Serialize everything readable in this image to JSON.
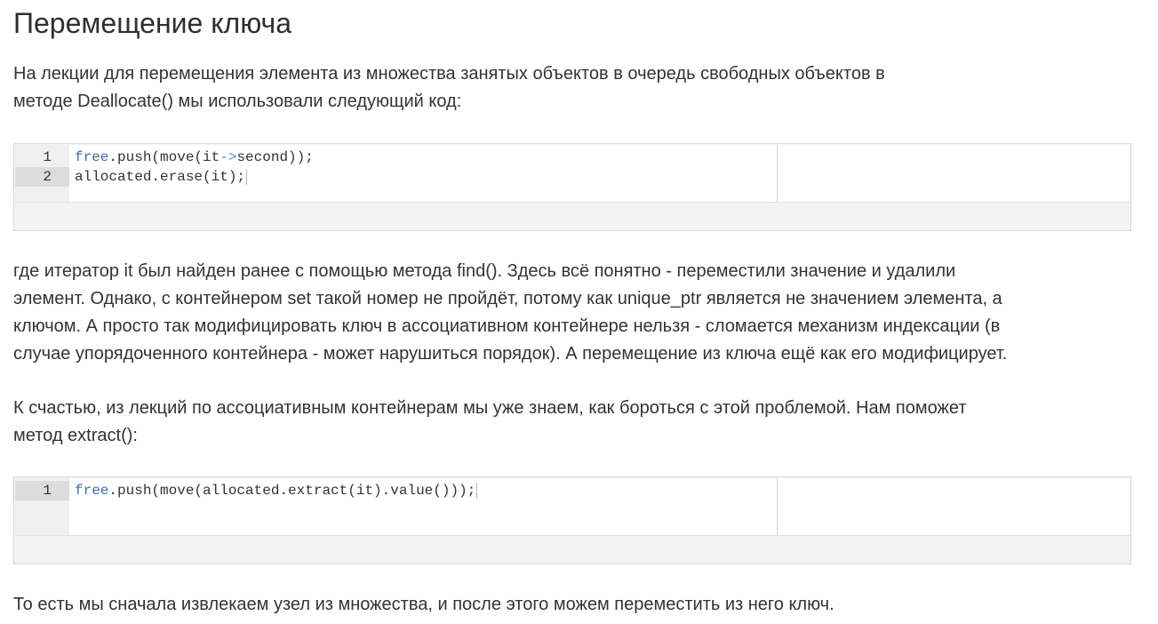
{
  "heading": "Перемещение ключа",
  "intro": [
    "На лекции для перемещения элемента из множества занятых объектов в очередь свободных объектов в",
    "методе Deallocate() мы использовали следующий код:"
  ],
  "code1": {
    "line_numbers": [
      "1",
      "2"
    ],
    "lines": [
      {
        "kw": "free",
        "rest_a": ".push(move(it",
        "op": "->",
        "rest_b": "second));"
      },
      {
        "text": "allocated.erase(it);"
      }
    ]
  },
  "explanation": [
    "где итератор it был найден ранее с помощью метода find(). Здесь всё понятно - переместили значение и удалили",
    "элемент. Однако, с контейнером set такой номер не пройдёт, потому как unique_ptr является не значением элемента, а",
    "ключом. А просто так модифицировать ключ в ассоциативном контейнере нельзя - сломается механизм индексации (в",
    "случае упорядоченного контейнера - может нарушиться порядок). А перемещение из ключа ещё как его модифицирует."
  ],
  "solution": [
    "К счастью, из лекций по ассоциативным контейнерам мы уже знаем, как бороться с этой проблемой. Нам поможет",
    "метод extract():"
  ],
  "code2": {
    "line_numbers": [
      "1"
    ],
    "lines": [
      {
        "kw": "free",
        "rest": ".push(move(allocated.extract(it).value()));"
      }
    ]
  },
  "conclusion": "То есть мы сначала извлекаем узел из множества, и после этого можем переместить из него ключ."
}
